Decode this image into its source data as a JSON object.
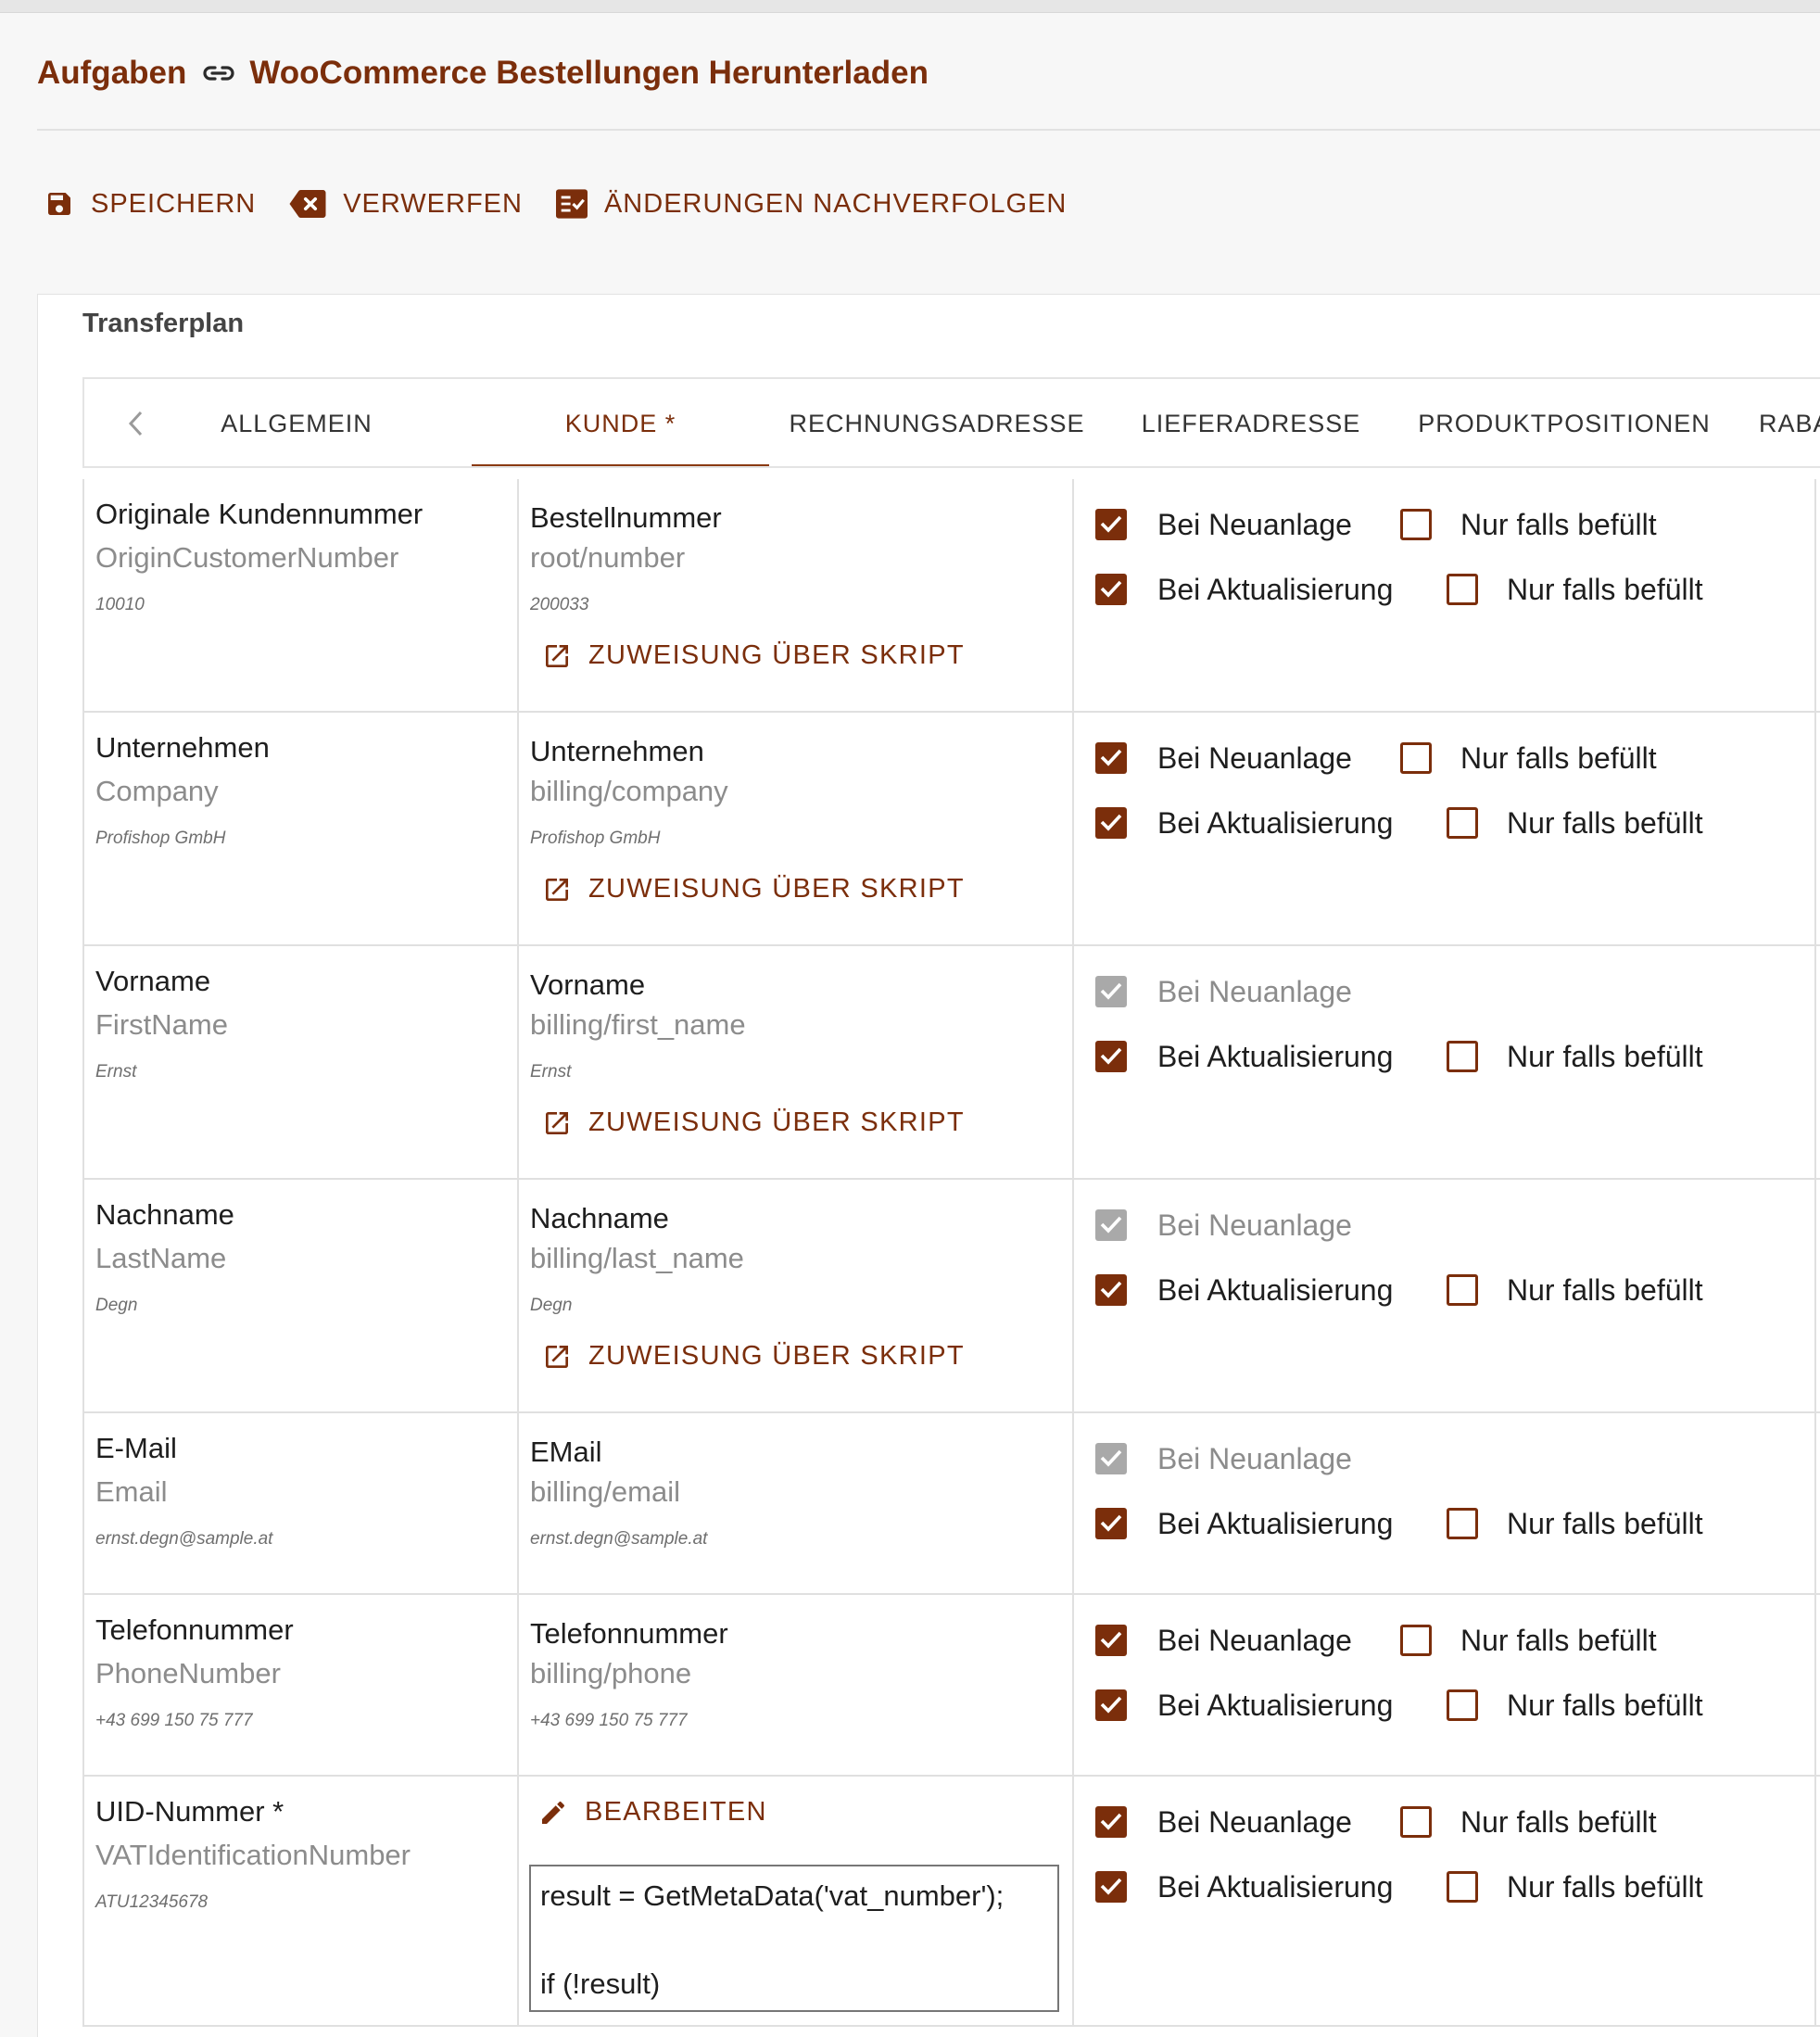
{
  "breadcrumb": {
    "parent": "Aufgaben",
    "current": "WooCommerce Bestellungen Herunterladen"
  },
  "toolbar": {
    "save": "SPEICHERN",
    "discard": "VERWERFEN",
    "track": "ÄNDERUNGEN NACHVERFOLGEN"
  },
  "panel": {
    "title": "Transferplan"
  },
  "tabs": [
    "ALLGEMEIN",
    "KUNDE *",
    "RECHNUNGSADRESSE",
    "LIEFERADRESSE",
    "PRODUKTPOSITIONEN",
    "RABA"
  ],
  "active_tab": "KUNDE *",
  "labels": {
    "script_assign": "ZUWEISUNG ÜBER SKRIPT",
    "edit": "BEARBEITEN",
    "on_create": "Bei Neuanlage",
    "on_update": "Bei Aktualisierung",
    "only_if_filled": "Nur falls befüllt"
  },
  "rows": [
    {
      "target_label": "Originale Kundennummer",
      "target_field": "OriginCustomerNumber",
      "target_sample": "10010",
      "source_label": "Bestellnummer",
      "source_path": "root/number",
      "source_sample": "200033",
      "on_create": "checked",
      "create_if_filled": false,
      "on_update": "checked",
      "update_if_filled": false
    },
    {
      "target_label": "Unternehmen",
      "target_field": "Company",
      "target_sample": "Profishop GmbH",
      "source_label": "Unternehmen",
      "source_path": "billing/company",
      "source_sample": "Profishop GmbH",
      "on_create": "checked",
      "create_if_filled": false,
      "on_update": "checked",
      "update_if_filled": false
    },
    {
      "target_label": "Vorname",
      "target_field": "FirstName",
      "target_sample": "Ernst",
      "source_label": "Vorname",
      "source_path": "billing/first_name",
      "source_sample": "Ernst",
      "on_create": "disabled",
      "on_update": "checked",
      "update_if_filled": false
    },
    {
      "target_label": "Nachname",
      "target_field": "LastName",
      "target_sample": "Degn",
      "source_label": "Nachname",
      "source_path": "billing/last_name",
      "source_sample": "Degn",
      "on_create": "disabled",
      "on_update": "checked",
      "update_if_filled": false
    },
    {
      "target_label": "E-Mail",
      "target_field": "Email",
      "target_sample": "ernst.degn@sample.at",
      "source_label": "EMail",
      "source_path": "billing/email",
      "source_sample": "ernst.degn@sample.at",
      "on_create": "disabled",
      "on_update": "checked",
      "update_if_filled": false
    },
    {
      "target_label": "Telefonnummer",
      "target_field": "PhoneNumber",
      "target_sample": "+43 699 150 75 777",
      "source_label": "Telefonnummer",
      "source_path": "billing/phone",
      "source_sample": "+43 699 150 75 777",
      "on_create": "checked",
      "create_if_filled": false,
      "on_update": "checked",
      "update_if_filled": false
    },
    {
      "target_label": "UID-Nummer *",
      "target_field": "VATIdentificationNumber",
      "target_sample": "ATU12345678",
      "script_lines": [
        "result = GetMetaData('vat_number');",
        "if (!result)"
      ],
      "on_create": "checked",
      "create_if_filled": false,
      "on_update": "checked",
      "update_if_filled": false
    }
  ],
  "colors": {
    "accent": "#7b2e0b",
    "disabled": "#a9a9a9",
    "border": "#e0e0e0"
  },
  "icons": [
    "link-icon",
    "save-icon",
    "discard-icon",
    "track-changes-icon",
    "chevron-left-icon",
    "open-in-new-icon",
    "pencil-icon",
    "checkmark-icon"
  ]
}
